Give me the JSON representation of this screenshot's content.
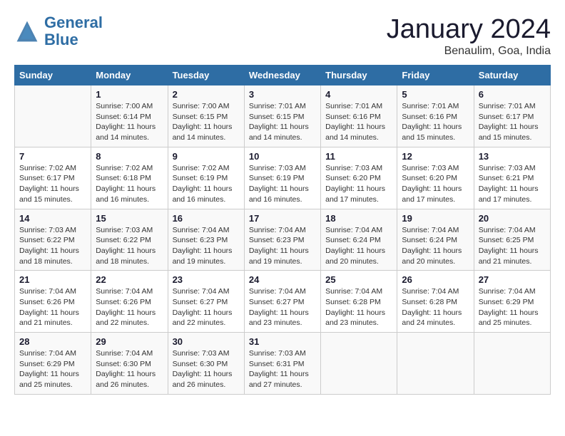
{
  "header": {
    "logo_line1": "General",
    "logo_line2": "Blue",
    "title": "January 2024",
    "subtitle": "Benaulim, Goa, India"
  },
  "weekdays": [
    "Sunday",
    "Monday",
    "Tuesday",
    "Wednesday",
    "Thursday",
    "Friday",
    "Saturday"
  ],
  "weeks": [
    [
      {
        "day": "",
        "sunrise": "",
        "sunset": "",
        "daylight": ""
      },
      {
        "day": "1",
        "sunrise": "Sunrise: 7:00 AM",
        "sunset": "Sunset: 6:14 PM",
        "daylight": "Daylight: 11 hours and 14 minutes."
      },
      {
        "day": "2",
        "sunrise": "Sunrise: 7:00 AM",
        "sunset": "Sunset: 6:15 PM",
        "daylight": "Daylight: 11 hours and 14 minutes."
      },
      {
        "day": "3",
        "sunrise": "Sunrise: 7:01 AM",
        "sunset": "Sunset: 6:15 PM",
        "daylight": "Daylight: 11 hours and 14 minutes."
      },
      {
        "day": "4",
        "sunrise": "Sunrise: 7:01 AM",
        "sunset": "Sunset: 6:16 PM",
        "daylight": "Daylight: 11 hours and 14 minutes."
      },
      {
        "day": "5",
        "sunrise": "Sunrise: 7:01 AM",
        "sunset": "Sunset: 6:16 PM",
        "daylight": "Daylight: 11 hours and 15 minutes."
      },
      {
        "day": "6",
        "sunrise": "Sunrise: 7:01 AM",
        "sunset": "Sunset: 6:17 PM",
        "daylight": "Daylight: 11 hours and 15 minutes."
      }
    ],
    [
      {
        "day": "7",
        "sunrise": "Sunrise: 7:02 AM",
        "sunset": "Sunset: 6:17 PM",
        "daylight": "Daylight: 11 hours and 15 minutes."
      },
      {
        "day": "8",
        "sunrise": "Sunrise: 7:02 AM",
        "sunset": "Sunset: 6:18 PM",
        "daylight": "Daylight: 11 hours and 16 minutes."
      },
      {
        "day": "9",
        "sunrise": "Sunrise: 7:02 AM",
        "sunset": "Sunset: 6:19 PM",
        "daylight": "Daylight: 11 hours and 16 minutes."
      },
      {
        "day": "10",
        "sunrise": "Sunrise: 7:03 AM",
        "sunset": "Sunset: 6:19 PM",
        "daylight": "Daylight: 11 hours and 16 minutes."
      },
      {
        "day": "11",
        "sunrise": "Sunrise: 7:03 AM",
        "sunset": "Sunset: 6:20 PM",
        "daylight": "Daylight: 11 hours and 17 minutes."
      },
      {
        "day": "12",
        "sunrise": "Sunrise: 7:03 AM",
        "sunset": "Sunset: 6:20 PM",
        "daylight": "Daylight: 11 hours and 17 minutes."
      },
      {
        "day": "13",
        "sunrise": "Sunrise: 7:03 AM",
        "sunset": "Sunset: 6:21 PM",
        "daylight": "Daylight: 11 hours and 17 minutes."
      }
    ],
    [
      {
        "day": "14",
        "sunrise": "Sunrise: 7:03 AM",
        "sunset": "Sunset: 6:22 PM",
        "daylight": "Daylight: 11 hours and 18 minutes."
      },
      {
        "day": "15",
        "sunrise": "Sunrise: 7:03 AM",
        "sunset": "Sunset: 6:22 PM",
        "daylight": "Daylight: 11 hours and 18 minutes."
      },
      {
        "day": "16",
        "sunrise": "Sunrise: 7:04 AM",
        "sunset": "Sunset: 6:23 PM",
        "daylight": "Daylight: 11 hours and 19 minutes."
      },
      {
        "day": "17",
        "sunrise": "Sunrise: 7:04 AM",
        "sunset": "Sunset: 6:23 PM",
        "daylight": "Daylight: 11 hours and 19 minutes."
      },
      {
        "day": "18",
        "sunrise": "Sunrise: 7:04 AM",
        "sunset": "Sunset: 6:24 PM",
        "daylight": "Daylight: 11 hours and 20 minutes."
      },
      {
        "day": "19",
        "sunrise": "Sunrise: 7:04 AM",
        "sunset": "Sunset: 6:24 PM",
        "daylight": "Daylight: 11 hours and 20 minutes."
      },
      {
        "day": "20",
        "sunrise": "Sunrise: 7:04 AM",
        "sunset": "Sunset: 6:25 PM",
        "daylight": "Daylight: 11 hours and 21 minutes."
      }
    ],
    [
      {
        "day": "21",
        "sunrise": "Sunrise: 7:04 AM",
        "sunset": "Sunset: 6:26 PM",
        "daylight": "Daylight: 11 hours and 21 minutes."
      },
      {
        "day": "22",
        "sunrise": "Sunrise: 7:04 AM",
        "sunset": "Sunset: 6:26 PM",
        "daylight": "Daylight: 11 hours and 22 minutes."
      },
      {
        "day": "23",
        "sunrise": "Sunrise: 7:04 AM",
        "sunset": "Sunset: 6:27 PM",
        "daylight": "Daylight: 11 hours and 22 minutes."
      },
      {
        "day": "24",
        "sunrise": "Sunrise: 7:04 AM",
        "sunset": "Sunset: 6:27 PM",
        "daylight": "Daylight: 11 hours and 23 minutes."
      },
      {
        "day": "25",
        "sunrise": "Sunrise: 7:04 AM",
        "sunset": "Sunset: 6:28 PM",
        "daylight": "Daylight: 11 hours and 23 minutes."
      },
      {
        "day": "26",
        "sunrise": "Sunrise: 7:04 AM",
        "sunset": "Sunset: 6:28 PM",
        "daylight": "Daylight: 11 hours and 24 minutes."
      },
      {
        "day": "27",
        "sunrise": "Sunrise: 7:04 AM",
        "sunset": "Sunset: 6:29 PM",
        "daylight": "Daylight: 11 hours and 25 minutes."
      }
    ],
    [
      {
        "day": "28",
        "sunrise": "Sunrise: 7:04 AM",
        "sunset": "Sunset: 6:29 PM",
        "daylight": "Daylight: 11 hours and 25 minutes."
      },
      {
        "day": "29",
        "sunrise": "Sunrise: 7:04 AM",
        "sunset": "Sunset: 6:30 PM",
        "daylight": "Daylight: 11 hours and 26 minutes."
      },
      {
        "day": "30",
        "sunrise": "Sunrise: 7:03 AM",
        "sunset": "Sunset: 6:30 PM",
        "daylight": "Daylight: 11 hours and 26 minutes."
      },
      {
        "day": "31",
        "sunrise": "Sunrise: 7:03 AM",
        "sunset": "Sunset: 6:31 PM",
        "daylight": "Daylight: 11 hours and 27 minutes."
      },
      {
        "day": "",
        "sunrise": "",
        "sunset": "",
        "daylight": ""
      },
      {
        "day": "",
        "sunrise": "",
        "sunset": "",
        "daylight": ""
      },
      {
        "day": "",
        "sunrise": "",
        "sunset": "",
        "daylight": ""
      }
    ]
  ]
}
